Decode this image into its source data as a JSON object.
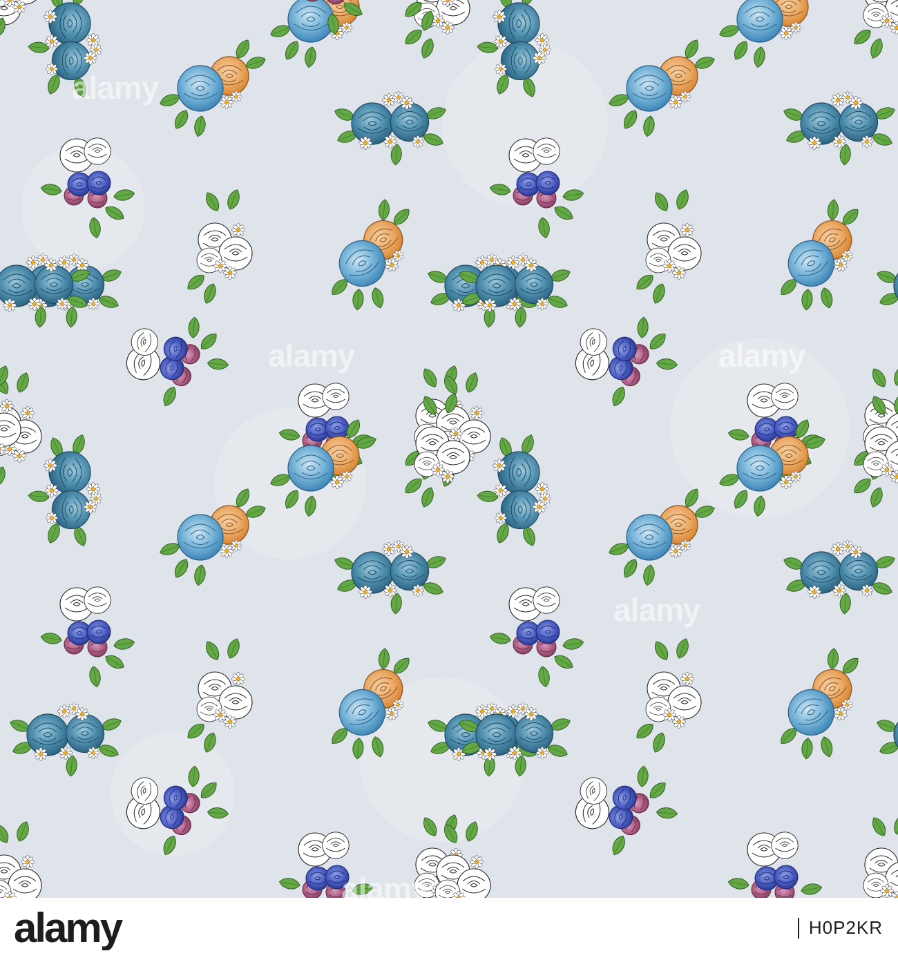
{
  "image": {
    "background_color": "#dfe3ea",
    "motifs": [
      "blue-rose-bouquet",
      "orange-and-blue-rose",
      "outline-rose-cluster",
      "violet-rose-bouquet",
      "daisy"
    ],
    "watermark_text": "alamy"
  },
  "footer": {
    "brand": "alamy",
    "stock_id": "H0P2KR"
  },
  "colors": {
    "teal_rose": "#4f8fae",
    "light_blue_rose": "#77b4d8",
    "orange_rose": "#eaa863",
    "violet_rose": "#4b5dc2",
    "pink_rose": "#b25f87",
    "leaf": "#63a844"
  }
}
